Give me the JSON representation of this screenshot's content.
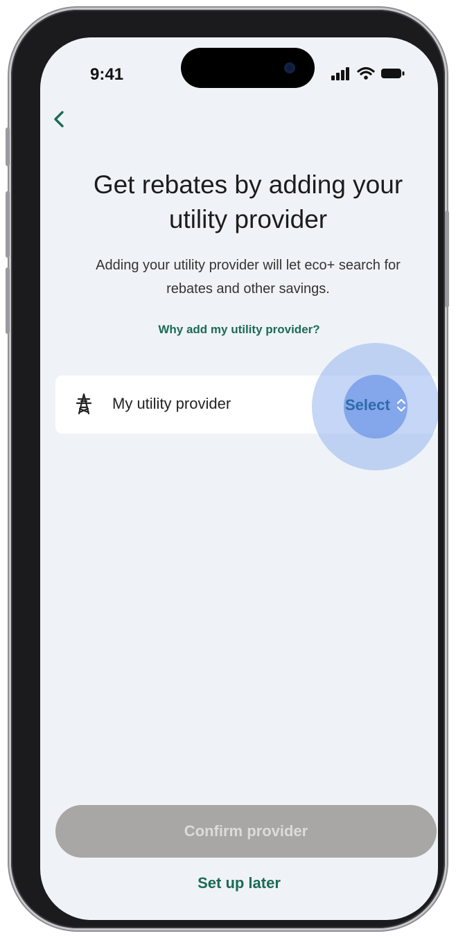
{
  "status_bar": {
    "time": "9:41"
  },
  "header": {
    "back_icon": "chevron-left-icon"
  },
  "content": {
    "title": "Get rebates by adding your utility provider",
    "subtitle": "Adding your utility provider will let eco+ search for rebates and other savings.",
    "why_link": "Why add my utility provider?"
  },
  "provider_selector": {
    "icon": "power-tower-icon",
    "label": "My utility provider",
    "select_label": "Select",
    "select_icon": "chevron-up-down-icon"
  },
  "footer": {
    "confirm_label": "Confirm provider",
    "setup_later_label": "Set up later"
  },
  "colors": {
    "accent_green": "#1b6b56",
    "screen_bg": "#eff3f7",
    "disabled_button": "#a9a6a6",
    "tap_highlight": "#7c9ee8"
  }
}
